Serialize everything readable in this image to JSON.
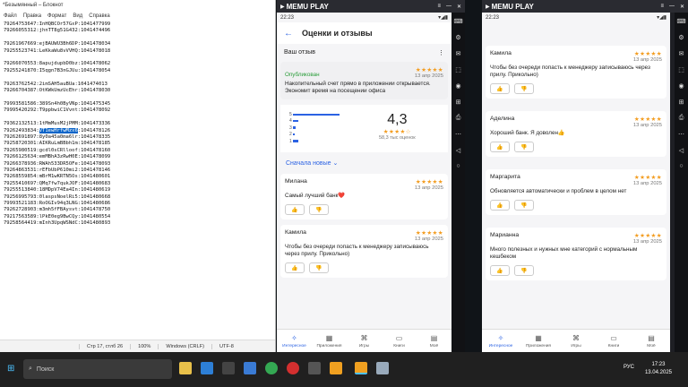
{
  "notepad": {
    "title": "*Безымянный – Блокнот",
    "menu": [
      "Файл",
      "Правка",
      "Формат",
      "Вид",
      "Справка"
    ],
    "lines": [
      "79264753647:InHQBCOr57GxP:1041477999",
      "79266055312:jhnTT8g51G432:1041474496",
      "",
      "79261967669:ejBAUWU3Bh6DP:1041478034",
      "79255523741:LeKkaWu8vVVHQ:1041478018",
      "",
      "79266070553:8apujdupbD0bz:1041478062",
      "79255241870:I5qgn7B3nGJUu:1041478054",
      "",
      "79263762542:2imSAH5auBUa:1041474013",
      "79266704387:OtKWkUmzUcEhr:1041478030",
      "",
      "79993581586:389Sn4h0ByVNp:1041475345",
      "79995420292:T9ppbwiC1Vvnt:1041478092",
      "",
      "79362132513:1tMmMusM2jPMM:1041473336"
    ],
    "sel_prefix": "79262493834:",
    "sel_text": "VT1ewHrfwMzx6",
    "sel_suffix": ":1041478126",
    "lines2": [
      "79262691897:8y0a45a0ma6lr:1041478335",
      "79258720301:AIKRuLmBBbh1m:1041478185",
      "79265980519:gcdl0sCRlloof:1041478160",
      "79266125634:emMBhA3zRwH0E:1041478099",
      "79266378936:RWAh533DR5OFe:1041478093",
      "79264863531:rEFbUbP610mi2:1041478146",
      "79268559854:mBrM1wKRTN5Os:1041480601",
      "79255410697:QMq7fw7qukJOF:1041480683",
      "79255513840:18MDpV74Ea4In:1041480619",
      "79256995793:0laspsNoelRi5:1041480668",
      "79993521183:RoOGIv94q3LNG:1041480686",
      "79262728903:m3mh5fFBAysvt:1041478750",
      "79217563589:lPkE0eg9BwCQy:1041480554",
      "79258564419:mInh3UpqWSNdC:1041480893"
    ],
    "status": [
      "Стр 17, стлб 26",
      "100%",
      "Windows (CRLF)",
      "UTF-8"
    ]
  },
  "emu1": {
    "brand": "MEMU PLAY",
    "time": "22:23",
    "header": "Оценки и отзывы",
    "your_review": "Ваш отзыв",
    "published": "Опубликован",
    "my_date": "13 апр 2025",
    "my_text": "Накопительный счет прямо в приложении открывается. Экономит время на посещении офиса",
    "rating": "4,3",
    "rating_count": "58,3 тыс оценок",
    "sort": "Сначала новые",
    "reviews": [
      {
        "name": "Милана",
        "date": "13 апр 2025",
        "text": "Самый лучший банк❤️"
      },
      {
        "name": "Камила",
        "date": "13 апр 2025",
        "text": "Чтобы без очереди попасть к менеджеру записываюсь через прилу. Прикольно)"
      }
    ]
  },
  "emu2": {
    "brand": "MEMU PLAY",
    "time": "22:23",
    "reviews": [
      {
        "name": "Камила",
        "date": "13 апр 2025",
        "text": "Чтобы без очереди попасть к менеджеру записываюсь через прилу. Прикольно)"
      },
      {
        "name": "Аделина",
        "date": "13 апр 2025",
        "text": "Хороший банк. Я доволен👍"
      },
      {
        "name": "Маргарита",
        "date": "13 апр 2025",
        "text": "Обновляется автоматически и проблем в целом нет"
      },
      {
        "name": "Марианна",
        "date": "13 апр 2025",
        "text": "Много полезных и нужных мне категорий с нормальным кешбеком"
      }
    ]
  },
  "nav": [
    "Интересное",
    "Приложения",
    "Игры",
    "Книги",
    "Моё"
  ],
  "taskbar": {
    "search": "Поиск",
    "lang": "РУС",
    "time": "17:23",
    "date": "13.04.2025"
  },
  "stars_full": "★★★★★",
  "stars_rating": "★★★★☆"
}
